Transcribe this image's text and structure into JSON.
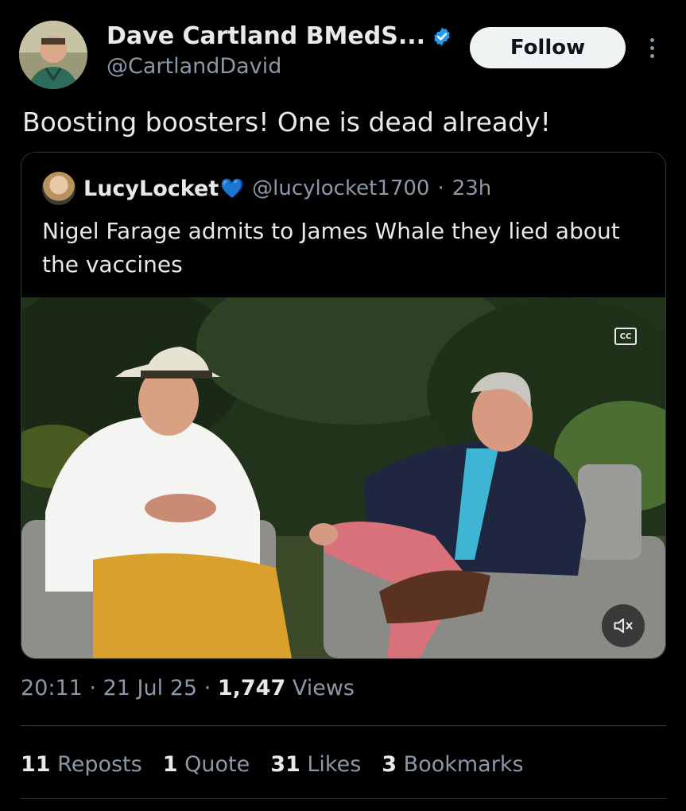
{
  "author": {
    "display_name": "Dave Cartland BMedS...",
    "handle": "@CartlandDavid",
    "avatar": "profile-photo",
    "verified_icon": "verified-badge-icon"
  },
  "actions": {
    "follow_label": "Follow",
    "more_icon": "more-vertical-icon"
  },
  "tweet": {
    "text": "Boosting boosters! One is dead already!"
  },
  "quoted": {
    "name": "LucyLocket",
    "emoji": "💙",
    "handle": "@lucylocket1700",
    "separator": "·",
    "time": "23h",
    "text": "Nigel Farage admits to James Whale they lied about the vaccines",
    "media": {
      "cc_label": "CC",
      "mute_icon": "volume-muted-icon"
    }
  },
  "meta": {
    "time": "20:11",
    "sep1": "·",
    "date": "21 Jul 25",
    "sep2": "·",
    "views_count": "1,747",
    "views_label": "Views"
  },
  "stats": [
    {
      "count": "11",
      "label": "Reposts"
    },
    {
      "count": "1",
      "label": "Quote"
    },
    {
      "count": "31",
      "label": "Likes"
    },
    {
      "count": "3",
      "label": "Bookmarks"
    }
  ],
  "colors": {
    "background": "#000000",
    "text": "#e7e9ea",
    "muted": "#8b98a5",
    "accent": "#1d9bf0",
    "border": "#2f3336"
  }
}
